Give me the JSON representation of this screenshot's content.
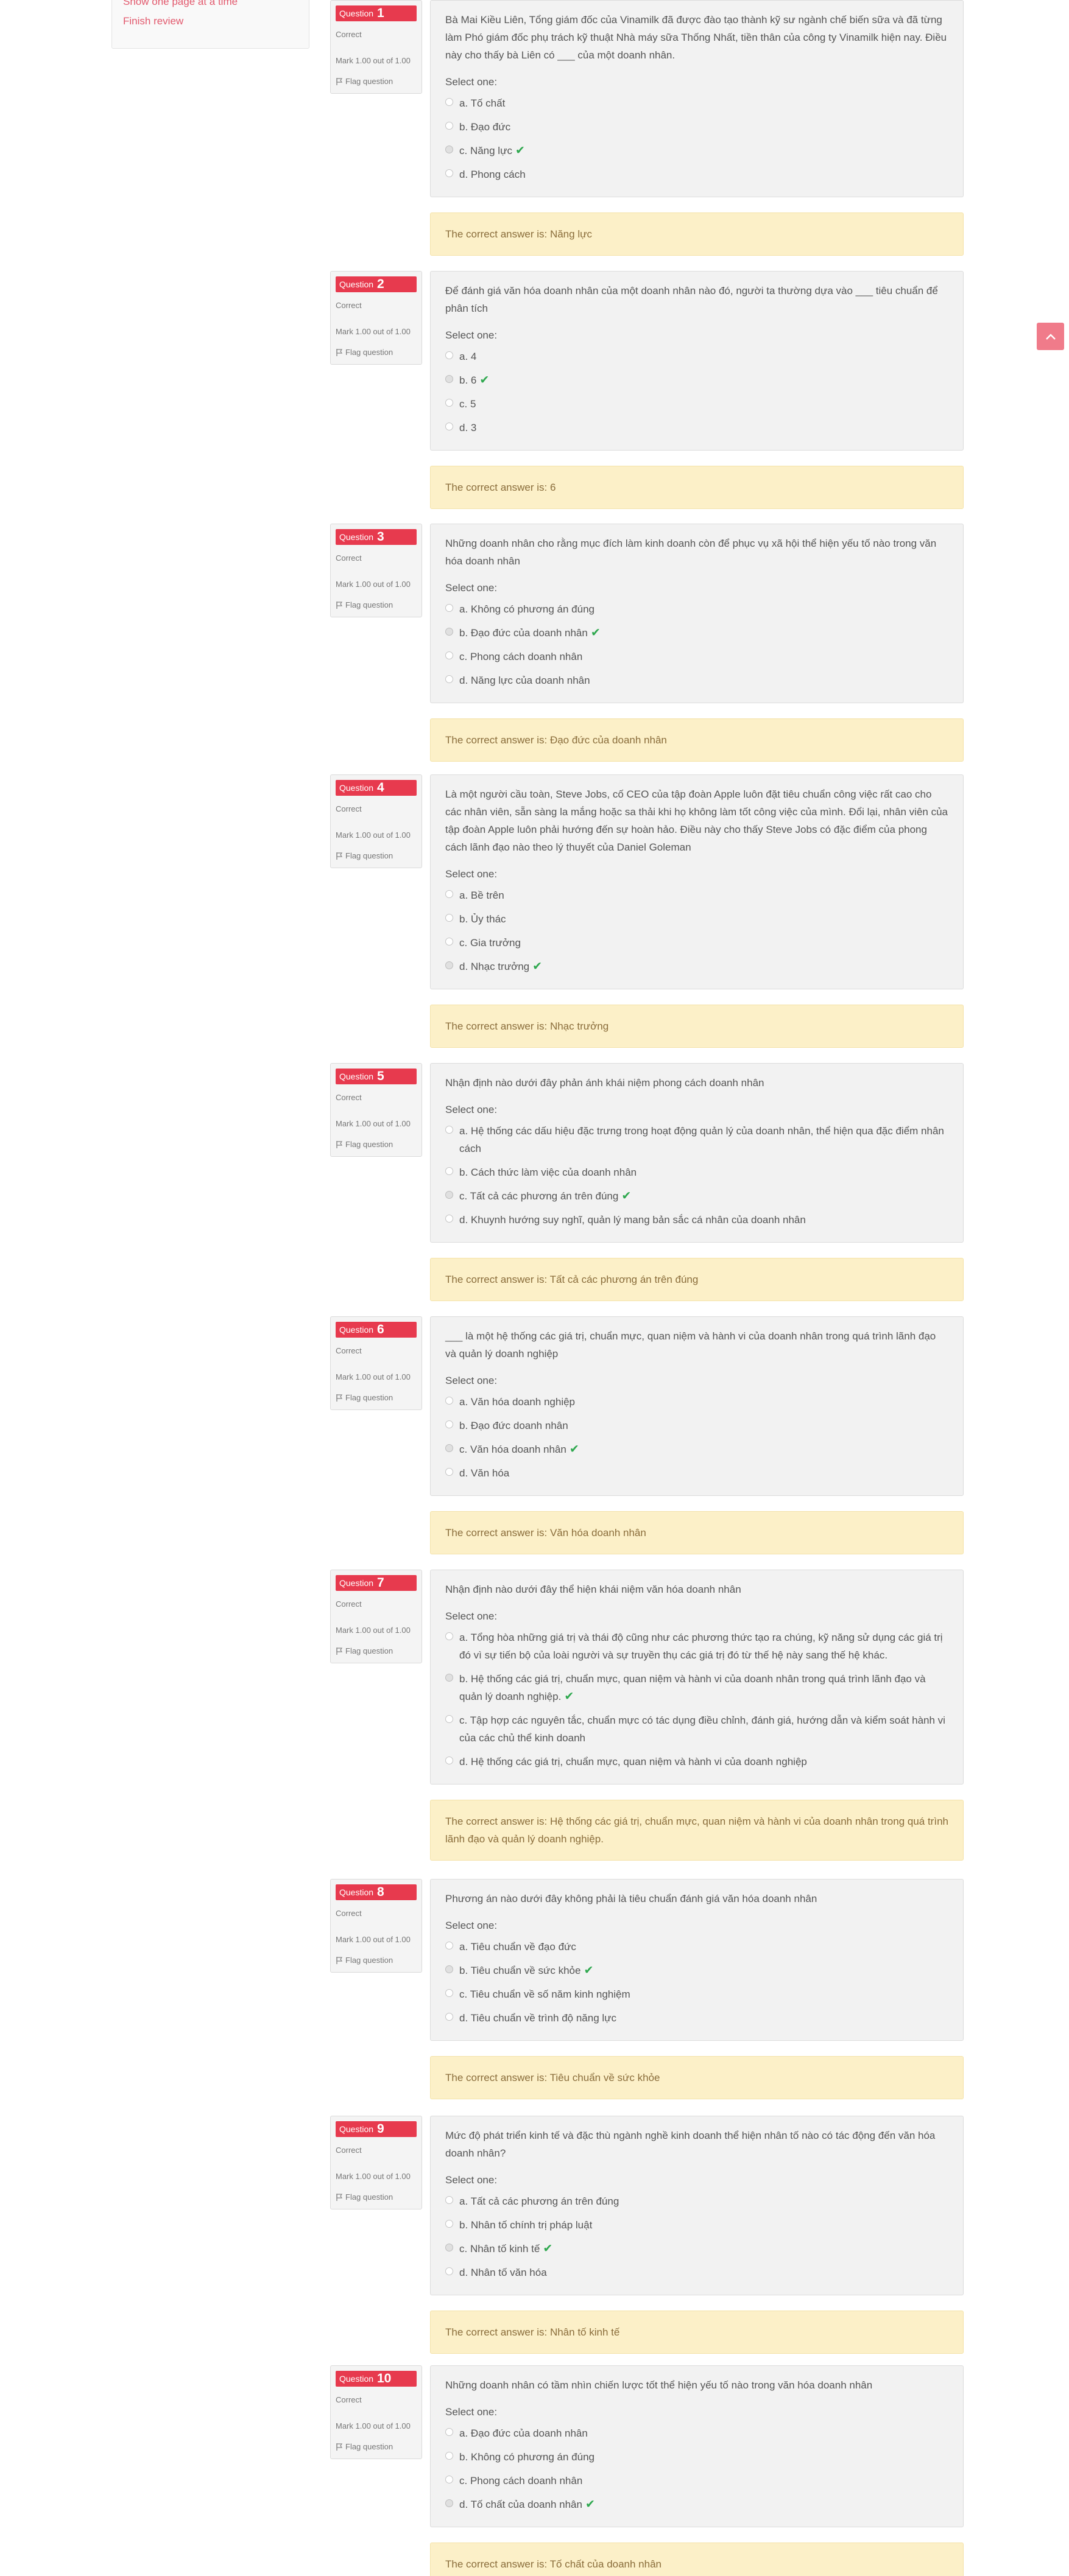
{
  "sidebar": {
    "show_page_label": "Show one page at a time",
    "finish_review_label": "Finish review"
  },
  "labels": {
    "question_word": "Question",
    "state": "Correct",
    "mark": "Mark 1.00 out of 1.00",
    "flag": "Flag question",
    "select_one": "Select one:",
    "correct_prefix": "The correct answer is: "
  },
  "questions": [
    {
      "number": "1",
      "text": "Bà Mai Kiều Liên, Tổng giám đốc của Vinamilk đã được đào tạo thành kỹ sư ngành chế biến sữa và đã từng làm Phó giám đốc phụ trách kỹ thuật Nhà máy sữa Thống Nhất, tiền thân của công ty Vinamilk hiện nay. Điều này cho thấy bà Liên có ___ của một doanh nhân.",
      "options": [
        "a. Tố chất",
        "b. Đạo đức",
        "c. Năng lực",
        "d. Phong cách"
      ],
      "selected": 2,
      "correct_answer": "Năng lực"
    },
    {
      "number": "2",
      "text": "Để đánh giá văn hóa doanh nhân của một doanh nhân nào đó, người ta thường dựa vào ___ tiêu chuẩn để phân tích",
      "options": [
        "a. 4",
        "b. 6",
        "c. 5",
        "d. 3"
      ],
      "selected": 1,
      "correct_answer": "6"
    },
    {
      "number": "3",
      "text": "Những doanh nhân cho rằng mục đích làm kinh doanh còn để phục vụ xã hội thể hiện yếu tố nào trong văn hóa doanh nhân",
      "options": [
        "a. Không có phương án đúng",
        "b. Đạo đức của doanh nhân",
        "c. Phong cách doanh nhân",
        "d. Năng lực của doanh nhân"
      ],
      "selected": 1,
      "correct_answer": "Đạo đức của doanh nhân"
    },
    {
      "number": "4",
      "text": "Là một người cầu toàn, Steve Jobs, cố CEO của tập đoàn Apple luôn đặt tiêu chuẩn công việc rất cao cho các nhân viên, sẵn sàng la mắng hoặc sa thải khi họ không làm tốt công việc của mình. Đổi lại, nhân viên của tập đoàn Apple luôn phải hướng đến sự hoàn hảo. Điều này cho thấy Steve Jobs có đặc điểm của phong cách lãnh đạo nào theo lý thuyết của Daniel Goleman",
      "options": [
        "a. Bề trên",
        "b. Ủy thác",
        "c. Gia trưởng",
        "d. Nhạc trưởng"
      ],
      "selected": 3,
      "correct_answer": "Nhạc trưởng"
    },
    {
      "number": "5",
      "text": "Nhận định nào dưới đây phản ánh khái niệm phong cách doanh nhân",
      "options": [
        "a. Hệ thống các dấu hiệu đặc trưng trong hoạt động quản lý của doanh nhân, thể hiện qua đặc điểm nhân cách",
        "b. Cách thức làm việc của doanh nhân",
        "c. Tất cả các phương án trên đúng",
        "d. Khuynh hướng suy nghĩ, quản lý mang bản sắc cá nhân của doanh nhân"
      ],
      "selected": 2,
      "correct_answer": "Tất cả các phương án trên đúng"
    },
    {
      "number": "6",
      "text": "___ là một hệ thống các giá trị, chuẩn mực, quan niệm và hành vi của doanh nhân trong quá trình lãnh đạo và quản lý doanh nghiệp",
      "options": [
        "a. Văn hóa doanh nghiệp",
        "b. Đạo đức doanh nhân",
        "c. Văn hóa doanh nhân",
        "d. Văn hóa"
      ],
      "selected": 2,
      "correct_answer": "Văn hóa doanh nhân"
    },
    {
      "number": "7",
      "text": "Nhận định nào dưới đây thể hiện khái niệm văn hóa doanh nhân",
      "options": [
        "a. Tổng hòa những giá trị và thái độ cũng như các phương thức tạo ra chúng, kỹ năng sử dụng các giá trị đó vì sự tiến bộ của loài người và sự truyền thụ các giá trị đó từ thế hệ này sang thế hệ khác.",
        "b. Hệ thống các giá trị, chuẩn mực, quan niệm và hành vi của doanh nhân trong quá trình lãnh đạo và quản lý doanh nghiệp.",
        "c. Tập hợp các nguyên tắc, chuẩn mực có tác dụng điều chỉnh, đánh giá, hướng dẫn và kiểm soát hành vi của các chủ thể kinh doanh",
        "d. Hệ thống các giá trị, chuẩn mực, quan niệm và hành vi của doanh nghiệp"
      ],
      "selected": 1,
      "correct_answer": "Hệ thống các giá trị, chuẩn mực, quan niệm và hành vi của doanh nhân trong quá trình lãnh đạo và quản lý doanh nghiệp."
    },
    {
      "number": "8",
      "text": "Phương án nào dưới đây không phải là tiêu chuẩn đánh giá văn hóa doanh nhân",
      "options": [
        "a. Tiêu chuẩn về đạo đức",
        "b. Tiêu chuẩn về sức khỏe",
        "c. Tiêu chuẩn về số năm kinh nghiệm",
        "d. Tiêu chuẩn về trình độ năng lực"
      ],
      "selected": 1,
      "correct_answer": "Tiêu chuẩn về sức khỏe"
    },
    {
      "number": "9",
      "text": "Mức độ phát triển kinh tế và đặc thù ngành nghề kinh doanh thể hiện nhân tố nào có tác động đến văn hóa doanh nhân?",
      "options": [
        "a. Tất cả các phương án trên đúng",
        "b. Nhân tố chính trị pháp luật",
        "c. Nhân tố kinh tế",
        "d. Nhân tố văn hóa"
      ],
      "selected": 2,
      "correct_answer": "Nhân tố kinh tế"
    },
    {
      "number": "10",
      "text": "Những doanh nhân có tầm nhìn chiến lược tốt thể hiện yếu tố nào trong văn hóa doanh nhân",
      "options": [
        "a. Đạo đức của doanh nhân",
        "b. Không có phương án đúng",
        "c. Phong cách doanh nhân",
        "d. Tố chất của doanh nhân"
      ],
      "selected": 3,
      "correct_answer": "Tố chất của doanh nhân"
    }
  ]
}
